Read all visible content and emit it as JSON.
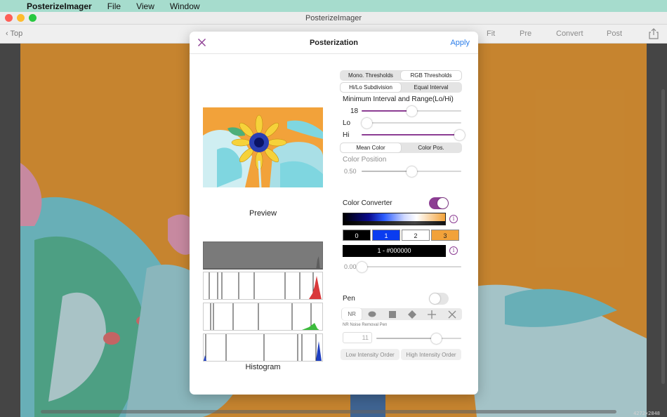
{
  "menubar": {
    "app_name": "PosterizeImager",
    "items": [
      "File",
      "View",
      "Window"
    ]
  },
  "window": {
    "title": "PosterizeImager"
  },
  "toolbar": {
    "back_label": "Top",
    "items": [
      "Fit",
      "Pre",
      "Convert",
      "Post"
    ]
  },
  "image_info": {
    "dimensions": "4272×2848"
  },
  "modal": {
    "title": "Posterization",
    "apply_label": "Apply",
    "preview_label": "Preview",
    "histogram_label": "Histogram",
    "threshold_modes": [
      "Mono. Thresholds",
      "RGB Thresholds"
    ],
    "threshold_selected": 1,
    "interval_modes": [
      "Hi/Lo Subdivision",
      "Equal Interval"
    ],
    "interval_selected": 0,
    "min_interval_label": "Minimum Interval and Range(Lo/Hi)",
    "min_interval_value": "18",
    "min_interval_fraction": 0.5,
    "lo_label": "Lo",
    "lo_fraction": 0.05,
    "hi_label": "Hi",
    "hi_fraction": 0.98,
    "color_modes": [
      "Mean Color",
      "Color Pos."
    ],
    "color_mode_selected": 0,
    "color_position_label": "Color Position",
    "color_position_value": "0.50",
    "color_position_fraction": 0.5,
    "color_converter_label": "Color Converter",
    "color_converter_on": true,
    "swatches": [
      {
        "label": "0",
        "bg": "#000000",
        "fg": "#ffffff"
      },
      {
        "label": "1",
        "bg": "#0a3cf0",
        "fg": "#ffffff"
      },
      {
        "label": "2",
        "bg": "#ffffff",
        "fg": "#222222"
      },
      {
        "label": "3",
        "bg": "#f2a23a",
        "fg": "#222222"
      }
    ],
    "selected_color_text": "1 - #000000",
    "converter_slider_value": "0.00",
    "converter_slider_fraction": 0.0,
    "pen_label": "Pen",
    "pen_on": false,
    "pen_tools": [
      "NR",
      "ellipse-icon",
      "square-icon",
      "diamond-icon",
      "plus-icon",
      "cross-icon"
    ],
    "nr_caption": "NR Noise Removal Pen",
    "pen_size_value": "11",
    "pen_size_fraction": 0.7,
    "order_buttons": [
      "Low Intensity Order",
      "High Intensity Order"
    ]
  },
  "colors": {
    "accent": "#8c3d93",
    "link": "#2b7de9",
    "image_bg": "#f2a23a"
  }
}
